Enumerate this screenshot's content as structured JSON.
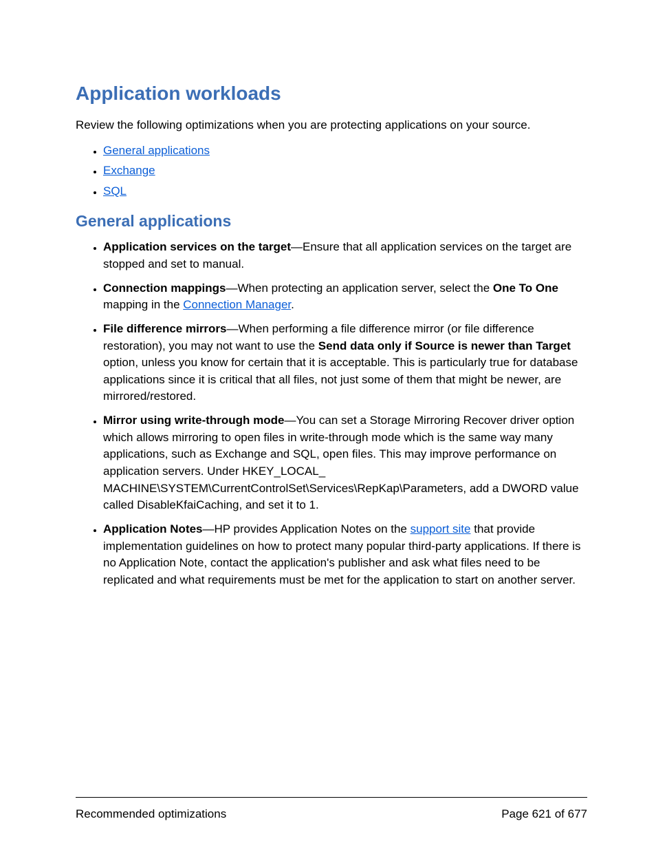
{
  "heading": "Application workloads",
  "intro": "Review the following optimizations when you are protecting applications on your source.",
  "toc": {
    "0": "General applications",
    "1": "Exchange",
    "2": "SQL"
  },
  "subheading": "General applications",
  "items": {
    "appServices": {
      "term": "Application services on the target",
      "text": "—Ensure that all application services on the target are stopped and set to manual."
    },
    "connMappings": {
      "term": "Connection mappings",
      "preText": "—When protecting an application server, select the ",
      "boldInline": "One To One",
      "midText": " mapping in the ",
      "link": "Connection Manager",
      "postText": "."
    },
    "fileDiff": {
      "term": "File difference mirrors",
      "preText": "—When performing a file difference mirror (or file difference restoration), you may not want to use the ",
      "boldInline1": "Send data only if Source is newer than Target",
      "postText": " option, unless you know for certain that it is acceptable. This is particularly true for database applications since it is critical that all files, not just some of them that might be newer, are mirrored/restored."
    },
    "mirrorWrite": {
      "term": "Mirror using write-through mode",
      "text": "—You can set a Storage Mirroring Recover driver option which allows mirroring to open files in write-through mode which is the same way many applications, such as Exchange and SQL, open files. This may improve performance on application servers. Under HKEY_LOCAL_ MACHINE\\SYSTEM\\CurrentControlSet\\Services\\RepKap\\Parameters, add a DWORD value called DisableKfaiCaching, and set it to 1."
    },
    "appNotes": {
      "term": "Application Notes",
      "preText": "—HP provides Application Notes on the ",
      "link": "support site",
      "postText": " that provide implementation guidelines on how to protect many popular third-party applications. If there is no Application Note, contact the application's publisher and ask what files need to be replicated and what requirements must be met for the application to start on another server."
    }
  },
  "footer": {
    "left": "Recommended optimizations",
    "right": "Page 621 of 677"
  }
}
